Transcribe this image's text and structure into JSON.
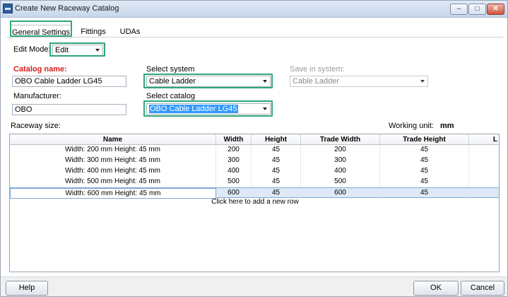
{
  "window": {
    "title": "Create New Raceway Catalog",
    "controls": {
      "minimize": "–",
      "maximize": "□",
      "close": "✕"
    }
  },
  "tabs": [
    {
      "label": "General Settings",
      "active": true
    },
    {
      "label": "Fittings",
      "active": false
    },
    {
      "label": "UDAs",
      "active": false
    }
  ],
  "form": {
    "edit_mode_label": "Edit Mode:",
    "edit_mode_value": "Edit",
    "catalog_name_label": "Catalog name:",
    "catalog_name_value": "OBO Cable Ladder LG45",
    "manufacturer_label": "Manufacturer:",
    "manufacturer_value": "OBO",
    "select_system_label": "Select system",
    "select_system_value": "Cable Ladder",
    "select_catalog_label": "Select catalog",
    "select_catalog_value": "OBO Cable Ladder LG45",
    "save_in_system_label": "Save in system:",
    "save_in_system_value": "Cable Ladder",
    "raceway_size_label": "Raceway size:",
    "working_unit_label": "Working unit:",
    "working_unit_value": "mm"
  },
  "grid": {
    "columns": [
      "Name",
      "Width",
      "Height",
      "Trade Width",
      "Trade Height",
      "L"
    ],
    "rows": [
      [
        "Width: 200 mm  Height: 45 mm",
        "200",
        "45",
        "200",
        "45"
      ],
      [
        "Width: 300 mm  Height: 45 mm",
        "300",
        "45",
        "300",
        "45"
      ],
      [
        "Width: 400 mm  Height: 45 mm",
        "400",
        "45",
        "400",
        "45"
      ],
      [
        "Width: 500 mm  Height: 45 mm",
        "500",
        "45",
        "500",
        "45"
      ],
      [
        "Width: 600 mm  Height: 45 mm",
        "600",
        "45",
        "600",
        "45"
      ]
    ],
    "selected_row": 4,
    "add_row_text": "Click here to add a new row"
  },
  "footer": {
    "help_label": "Help",
    "ok_label": "OK",
    "cancel_label": "Cancel"
  },
  "colors": {
    "highlight": "#2fa77a",
    "required_label": "#d6201f",
    "selection": "#3399ff"
  }
}
